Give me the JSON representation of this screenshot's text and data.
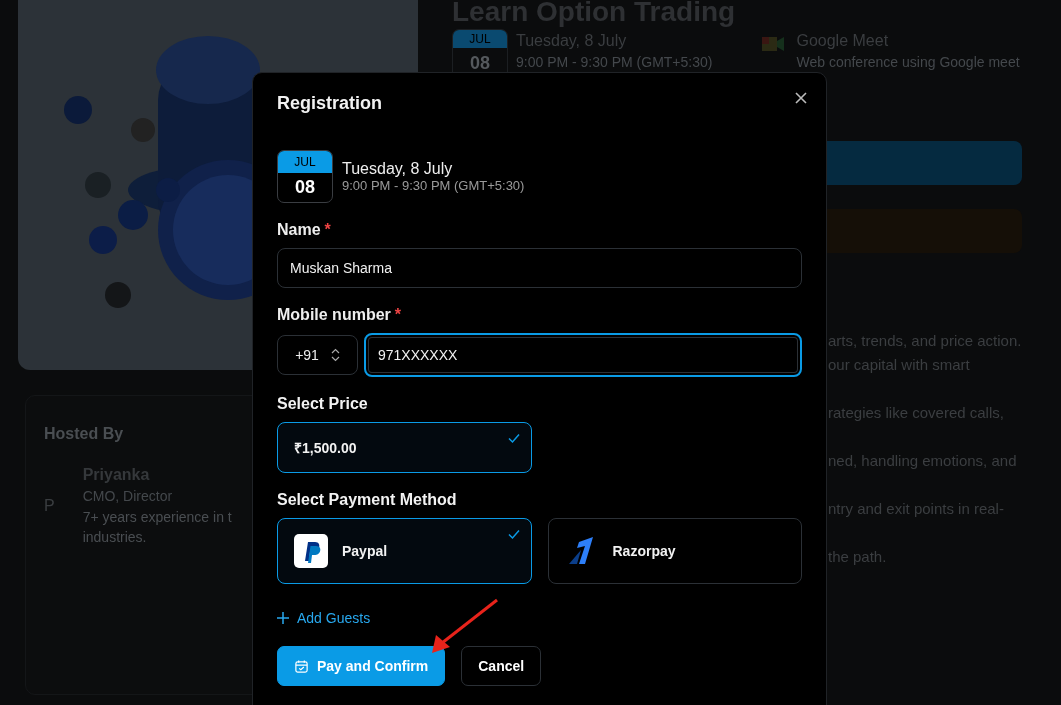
{
  "page": {
    "title": "Learn Option Trading",
    "event": {
      "month": "JUL",
      "day": "08",
      "date": "Tuesday, 8 July",
      "time": "9:00 PM - 9:30 PM (GMT+5:30)"
    },
    "location": {
      "name": "Google Meet",
      "detail": "Web conference using Google meet"
    },
    "description": [
      [
        "arts, trends, and price action.",
        "our capital with smart"
      ],
      [
        "rategies like covered calls,"
      ],
      [
        "ned, handling emotions, and"
      ],
      [
        "ntry and exit points in real-"
      ],
      [
        "the path."
      ]
    ],
    "host": {
      "heading": "Hosted By",
      "initial": "P",
      "name": "Priyanka",
      "role": "CMO, Director",
      "bio": [
        "7+ years experience in t",
        "industries."
      ]
    }
  },
  "modal": {
    "title": "Registration",
    "event": {
      "month": "JUL",
      "day": "08",
      "date": "Tuesday, 8 July",
      "time": "9:00 PM - 9:30 PM (GMT+5:30)"
    },
    "name_field": {
      "label": "Name",
      "required_mark": "*",
      "value": "Muskan Sharma",
      "focused": false
    },
    "mobile_field": {
      "label": "Mobile number",
      "required_mark": "*",
      "country_code": "+91",
      "value": "971XXXXXX",
      "focused": true
    },
    "price": {
      "label": "Select Price",
      "options": [
        {
          "label": "₹1,500.00",
          "selected": true
        }
      ]
    },
    "payment": {
      "label": "Select Payment Method",
      "options": [
        {
          "kind": "paypal",
          "label": "Paypal",
          "selected": true
        },
        {
          "kind": "razorpay",
          "label": "Razorpay",
          "selected": false
        }
      ]
    },
    "add_guests": "Add Guests",
    "buttons": [
      {
        "kind": "primary",
        "label": "Pay and Confirm"
      },
      {
        "kind": "secondary",
        "label": "Cancel"
      }
    ]
  }
}
